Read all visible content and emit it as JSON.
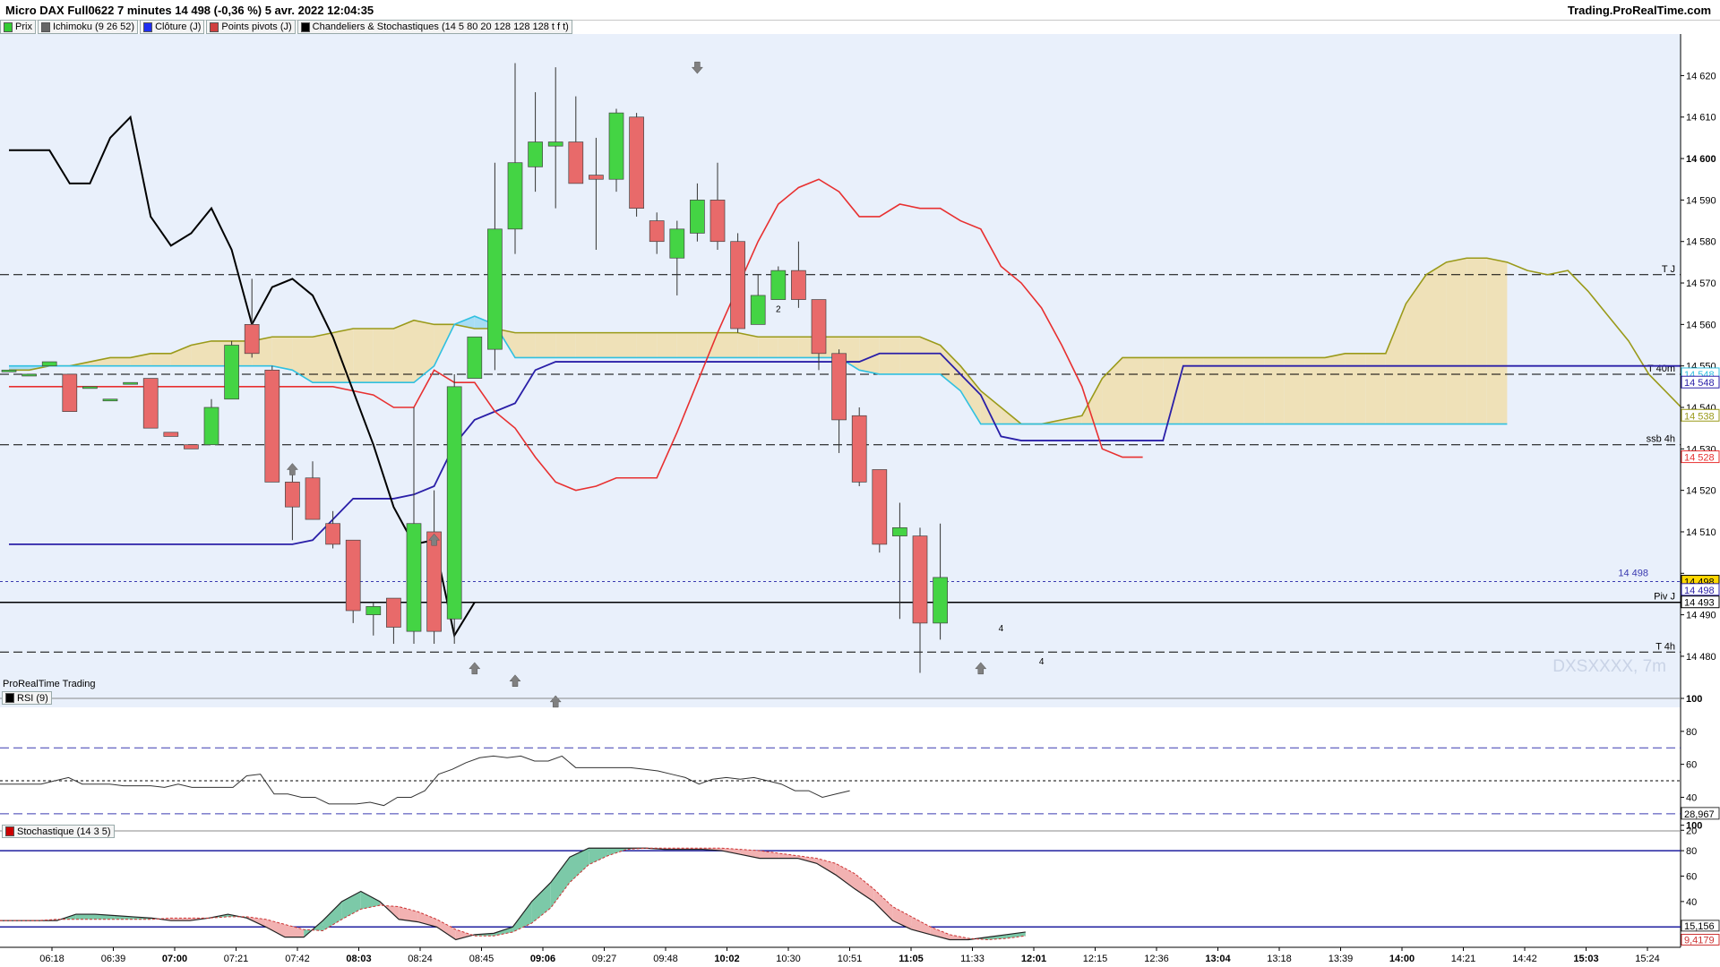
{
  "header": {
    "title": "Micro DAX Full0622 7 minutes 14 498 (-0,36 %) 5 avr. 2022 12:04:35",
    "brand": "Trading.ProRealTime.com"
  },
  "legend": [
    {
      "label": "Prix",
      "color": "#33cc33"
    },
    {
      "label": "Ichimoku (9 26 52)",
      "color": "#666666"
    },
    {
      "label": "Clôture (J)",
      "color": "#1f2ff0"
    },
    {
      "label": "Points pivots (J)",
      "color": "#d04040"
    },
    {
      "label": "Chandeliers & Stochastiques (14 5 80 20 128 128 128 t f t)",
      "color": "#000000"
    }
  ],
  "footer_label": "ProRealTime Trading",
  "watermark": "DXSXXXX, 7m",
  "colors": {
    "panel_bg": "#e9f0fb",
    "bull": "#44d444",
    "bear": "#e86a6a",
    "kumo_bull": "#a8ddf5",
    "kumo_bear": "#efe1b8",
    "tenkan": "#e83030",
    "kijun": "#2a1fa8",
    "chikou": "#000000",
    "ssb": "#9a9a1a",
    "ssa_line": "#30c0e0"
  },
  "chart_data": [
    {
      "type": "candlestick",
      "timeframe": "7m",
      "ylim": [
        14472,
        14627
      ],
      "yticks": [
        14480,
        14490,
        14500,
        14510,
        14520,
        14530,
        14540,
        14550,
        14560,
        14570,
        14580,
        14590,
        14600,
        14610,
        14620
      ],
      "ytick_labels": [
        "14 480",
        "14 490",
        "",
        "14 510",
        "14 520",
        "14 530",
        "14 540",
        "14 550",
        "14 560",
        "14 570",
        "14 580",
        "14 590",
        "14 600",
        "14 610",
        "14 620"
      ],
      "xtick_labels": [
        "06:18",
        "06:39",
        "07:00",
        "07:21",
        "07:42",
        "08:03",
        "08:24",
        "08:45",
        "09:06",
        "09:27",
        "09:48",
        "10:02",
        "10:30",
        "10:51",
        "11:05",
        "11:33",
        "12:01",
        "12:15",
        "12:36",
        "13:04",
        "13:18",
        "13:39",
        "14:00",
        "14:21",
        "14:42",
        "15:03",
        "15:24"
      ],
      "xtick_bold": [
        "07:00",
        "08:03",
        "09:06",
        "10:02",
        "11:05",
        "12:01",
        "13:04",
        "14:00",
        "15:03"
      ],
      "candles": [
        {
          "o": 14549,
          "h": 14549,
          "l": 14549,
          "c": 14549
        },
        {
          "o": 14548,
          "h": 14548,
          "l": 14548,
          "c": 14548
        },
        {
          "o": 14550,
          "h": 14550,
          "l": 14550,
          "c": 14551
        },
        {
          "o": 14548,
          "h": 14548,
          "l": 14539,
          "c": 14539
        },
        {
          "o": 14545,
          "h": 14545,
          "l": 14545,
          "c": 14545
        },
        {
          "o": 14542,
          "h": 14542,
          "l": 14542,
          "c": 14542
        },
        {
          "o": 14546,
          "h": 14546,
          "l": 14546,
          "c": 14546
        },
        {
          "o": 14547,
          "h": 14547,
          "l": 14535,
          "c": 14535
        },
        {
          "o": 14534,
          "h": 14534,
          "l": 14533,
          "c": 14533
        },
        {
          "o": 14531,
          "h": 14531,
          "l": 14530,
          "c": 14530
        },
        {
          "o": 14531,
          "h": 14542,
          "l": 14531,
          "c": 14540
        },
        {
          "o": 14542,
          "h": 14556,
          "l": 14542,
          "c": 14555
        },
        {
          "o": 14560,
          "h": 14571,
          "l": 14552,
          "c": 14553
        },
        {
          "o": 14549,
          "h": 14550,
          "l": 14522,
          "c": 14522
        },
        {
          "o": 14522,
          "h": 14524,
          "l": 14508,
          "c": 14516
        },
        {
          "o": 14523,
          "h": 14527,
          "l": 14513,
          "c": 14513
        },
        {
          "o": 14512,
          "h": 14515,
          "l": 14506,
          "c": 14507
        },
        {
          "o": 14508,
          "h": 14508,
          "l": 14488,
          "c": 14491
        },
        {
          "o": 14490,
          "h": 14493,
          "l": 14485,
          "c": 14492
        },
        {
          "o": 14494,
          "h": 14494,
          "l": 14483,
          "c": 14487
        },
        {
          "o": 14486,
          "h": 14540,
          "l": 14483,
          "c": 14512
        },
        {
          "o": 14510,
          "h": 14520,
          "l": 14483,
          "c": 14486
        },
        {
          "o": 14489,
          "h": 14548,
          "l": 14483,
          "c": 14545
        },
        {
          "o": 14547,
          "h": 14557,
          "l": 14547,
          "c": 14557
        },
        {
          "o": 14554,
          "h": 14599,
          "l": 14549,
          "c": 14583
        },
        {
          "o": 14583,
          "h": 14623,
          "l": 14577,
          "c": 14599
        },
        {
          "o": 14598,
          "h": 14616,
          "l": 14592,
          "c": 14604
        },
        {
          "o": 14603,
          "h": 14622,
          "l": 14588,
          "c": 14604
        },
        {
          "o": 14604,
          "h": 14615,
          "l": 14594,
          "c": 14594
        },
        {
          "o": 14596,
          "h": 14605,
          "l": 14578,
          "c": 14595
        },
        {
          "o": 14595,
          "h": 14612,
          "l": 14592,
          "c": 14611
        },
        {
          "o": 14610,
          "h": 14611,
          "l": 14586,
          "c": 14588
        },
        {
          "o": 14585,
          "h": 14587,
          "l": 14577,
          "c": 14580
        },
        {
          "o": 14576,
          "h": 14585,
          "l": 14567,
          "c": 14583
        },
        {
          "o": 14582,
          "h": 14594,
          "l": 14580,
          "c": 14590
        },
        {
          "o": 14590,
          "h": 14599,
          "l": 14578,
          "c": 14580
        },
        {
          "o": 14580,
          "h": 14582,
          "l": 14558,
          "c": 14559
        },
        {
          "o": 14560,
          "h": 14572,
          "l": 14560,
          "c": 14567
        },
        {
          "o": 14566,
          "h": 14574,
          "l": 14566,
          "c": 14573
        },
        {
          "o": 14573,
          "h": 14580,
          "l": 14564,
          "c": 14566
        },
        {
          "o": 14566,
          "h": 14566,
          "l": 14549,
          "c": 14553
        },
        {
          "o": 14553,
          "h": 14554,
          "l": 14529,
          "c": 14537
        },
        {
          "o": 14538,
          "h": 14540,
          "l": 14521,
          "c": 14522
        },
        {
          "o": 14525,
          "h": 14525,
          "l": 14505,
          "c": 14507
        },
        {
          "o": 14509,
          "h": 14517,
          "l": 14489,
          "c": 14511
        },
        {
          "o": 14509,
          "h": 14511,
          "l": 14476,
          "c": 14488
        },
        {
          "o": 14488,
          "h": 14512,
          "l": 14484,
          "c": 14499
        }
      ],
      "cloud": {
        "ssa": [
          14550,
          14550,
          14550,
          14550,
          14550,
          14550,
          14550,
          14550,
          14550,
          14550,
          14550,
          14550,
          14550,
          14550,
          14549,
          14546,
          14546,
          14546,
          14546,
          14546,
          14546,
          14550,
          14560,
          14562,
          14560,
          14552,
          14552,
          14552,
          14552,
          14552,
          14552,
          14552,
          14552,
          14552,
          14552,
          14552,
          14552,
          14552,
          14552,
          14552,
          14552,
          14552,
          14549,
          14548,
          14548,
          14548,
          14548,
          14544,
          14536,
          14536,
          14536,
          14536,
          14536,
          14536,
          14536,
          14536,
          14536,
          14536,
          14536,
          14536,
          14536,
          14536,
          14536,
          14536,
          14536,
          14536,
          14536,
          14536,
          14536,
          14536,
          14536,
          14536,
          14536,
          14536,
          14536
        ],
        "ssb": [
          14549,
          14549,
          14550,
          14550,
          14551,
          14552,
          14552,
          14553,
          14553,
          14555,
          14556,
          14556,
          14556,
          14557,
          14557,
          14557,
          14558,
          14559,
          14559,
          14559,
          14561,
          14560,
          14560,
          14559,
          14559,
          14558,
          14558,
          14558,
          14558,
          14558,
          14558,
          14558,
          14558,
          14558,
          14558,
          14558,
          14558,
          14557,
          14557,
          14557,
          14557,
          14557,
          14557,
          14557,
          14557,
          14557,
          14555,
          14550,
          14544,
          14540,
          14536,
          14536,
          14537,
          14538,
          14547,
          14552,
          14552,
          14552,
          14552,
          14552,
          14552,
          14552,
          14552,
          14552,
          14552,
          14552,
          14553,
          14553,
          14553,
          14565,
          14572,
          14575,
          14576,
          14576,
          14575,
          14573,
          14572,
          14573,
          14568,
          14562,
          14556,
          14548,
          14543,
          14538,
          14536
        ]
      },
      "tenkan": [
        14545,
        14545,
        14545,
        14545,
        14545,
        14545,
        14545,
        14545,
        14545,
        14545,
        14545,
        14545,
        14545,
        14545,
        14545,
        14545,
        14545,
        14544,
        14543,
        14540,
        14540,
        14549,
        14546,
        14546,
        14539,
        14535,
        14528,
        14522,
        14520,
        14521,
        14523,
        14523,
        14523,
        14534,
        14546,
        14558,
        14569,
        14580,
        14589,
        14593,
        14595,
        14592,
        14586,
        14586,
        14589,
        14588,
        14588,
        14585,
        14583,
        14574,
        14570,
        14564,
        14555,
        14545,
        14530,
        14528,
        14528
      ],
      "kijun": [
        14507,
        14507,
        14507,
        14507,
        14507,
        14507,
        14507,
        14507,
        14507,
        14507,
        14507,
        14507,
        14507,
        14507,
        14507,
        14508,
        14513,
        14518,
        14518,
        14518,
        14519,
        14521,
        14531,
        14537,
        14539,
        14541,
        14549,
        14551,
        14551,
        14551,
        14551,
        14551,
        14551,
        14551,
        14551,
        14551,
        14551,
        14551,
        14551,
        14551,
        14551,
        14551,
        14551,
        14553,
        14553,
        14553,
        14553,
        14548,
        14543,
        14533,
        14532,
        14532,
        14532,
        14532,
        14532,
        14532,
        14532,
        14532,
        14550,
        14550,
        14550,
        14550,
        14550,
        14550,
        14550,
        14550,
        14550,
        14550,
        14550,
        14550,
        14550,
        14550,
        14550,
        14550,
        14550,
        14550,
        14550,
        14550,
        14550,
        14550,
        14550,
        14550,
        14550,
        14550,
        14546,
        14546
      ],
      "chikou": [
        14602,
        14602,
        14602,
        14594,
        14594,
        14605,
        14610,
        14586,
        14579,
        14582,
        14588,
        14578,
        14560,
        14569,
        14571,
        14567,
        14557,
        14544,
        14531,
        14516,
        14507,
        14508,
        14485,
        14493
      ],
      "levels": [
        {
          "name": "T J",
          "value": 14572,
          "style": "dashed"
        },
        {
          "name": "T 40m",
          "value": 14548,
          "style": "dashed"
        },
        {
          "name": "ssb 4h",
          "value": 14531,
          "style": "dashed"
        },
        {
          "name": "",
          "value": 14498,
          "style": "dotted"
        },
        {
          "name": "Piv J",
          "value": 14493,
          "style": "solid"
        },
        {
          "name": "T 4h",
          "value": 14481,
          "style": "dashed"
        }
      ],
      "price_label_inline": "14 498",
      "axis_badges": [
        {
          "text": "14 548",
          "value": 14548,
          "color": "#30c0e0"
        },
        {
          "text": "14 548",
          "value": 14546,
          "color": "#2a1fa8"
        },
        {
          "text": "14 538",
          "value": 14538,
          "color": "#9a9a1a"
        },
        {
          "text": "14 528",
          "value": 14528,
          "color": "#e83030"
        },
        {
          "text": "14 498",
          "value": 14498,
          "color": "#000000",
          "fill": "#ffd800"
        },
        {
          "text": "14 498",
          "value": 14496,
          "color": "#2a1fa8"
        },
        {
          "text": "14 493",
          "value": 14493,
          "color": "#000000"
        }
      ],
      "signal_arrows": [
        {
          "x_index": 14,
          "value": 14525,
          "dir": "up"
        },
        {
          "x_index": 21,
          "value": 14508,
          "dir": "up"
        },
        {
          "x_index": 23,
          "value": 14477,
          "dir": "up"
        },
        {
          "x_index": 25,
          "value": 14474,
          "dir": "up"
        },
        {
          "x_index": 27,
          "value": 14469,
          "dir": "up"
        },
        {
          "x_index": 34,
          "value": 14622,
          "dir": "down"
        },
        {
          "x_index": 48,
          "value": 14477,
          "dir": "up"
        }
      ],
      "digit_markers": [
        {
          "text": "2",
          "x_index": 38,
          "value": 14563
        },
        {
          "text": "4",
          "x_index": 49,
          "value": 14486
        },
        {
          "text": "4",
          "x_index": 51,
          "value": 14478
        }
      ]
    },
    {
      "type": "line",
      "title": "RSI (9)",
      "ylim": [
        12,
        100
      ],
      "yticks": [
        20,
        40,
        60,
        80,
        100
      ],
      "levels": [
        70,
        50,
        30
      ],
      "values": [
        48,
        48,
        48,
        48,
        50,
        52,
        48,
        48,
        48,
        47,
        47,
        47,
        46,
        48,
        46,
        46,
        46,
        46,
        53,
        54,
        42,
        42,
        40,
        40,
        36,
        36,
        36,
        37,
        35,
        40,
        40,
        44,
        54,
        57,
        61,
        64,
        65,
        64,
        65,
        62,
        62,
        65,
        58,
        58,
        58,
        58,
        58,
        57,
        56,
        54,
        52,
        48,
        51,
        52,
        51,
        52,
        50,
        48,
        44,
        44,
        40,
        42,
        44
      ],
      "last_label": "28,967"
    },
    {
      "type": "line",
      "title": "Stochastique (14 3 5)",
      "ylim": [
        4,
        104
      ],
      "yticks": [
        20,
        40,
        60,
        80,
        100
      ],
      "levels": [
        80,
        20
      ],
      "k": [
        25,
        25,
        25,
        25,
        30,
        30,
        29,
        28,
        27,
        25,
        25,
        27,
        30,
        27,
        20,
        12,
        12,
        25,
        40,
        48,
        40,
        26,
        24,
        20,
        10,
        14,
        15,
        20,
        40,
        55,
        75,
        82,
        82,
        82,
        82,
        81,
        81,
        81,
        80,
        77,
        74,
        74,
        74,
        70,
        61,
        50,
        40,
        25,
        18,
        14,
        10,
        10,
        12,
        14,
        16
      ],
      "d": [
        25,
        25,
        25,
        26,
        26,
        26,
        26,
        26,
        26,
        27,
        27,
        27,
        28,
        28,
        26,
        22,
        18,
        17,
        26,
        34,
        37,
        36,
        32,
        26,
        18,
        13,
        13,
        16,
        23,
        35,
        55,
        69,
        76,
        81,
        82,
        82,
        82,
        82,
        82,
        81,
        80,
        78,
        76,
        74,
        70,
        62,
        50,
        36,
        28,
        20,
        14,
        11,
        10,
        11,
        13
      ],
      "last_labels": [
        "15,156",
        "9,4179"
      ]
    }
  ]
}
